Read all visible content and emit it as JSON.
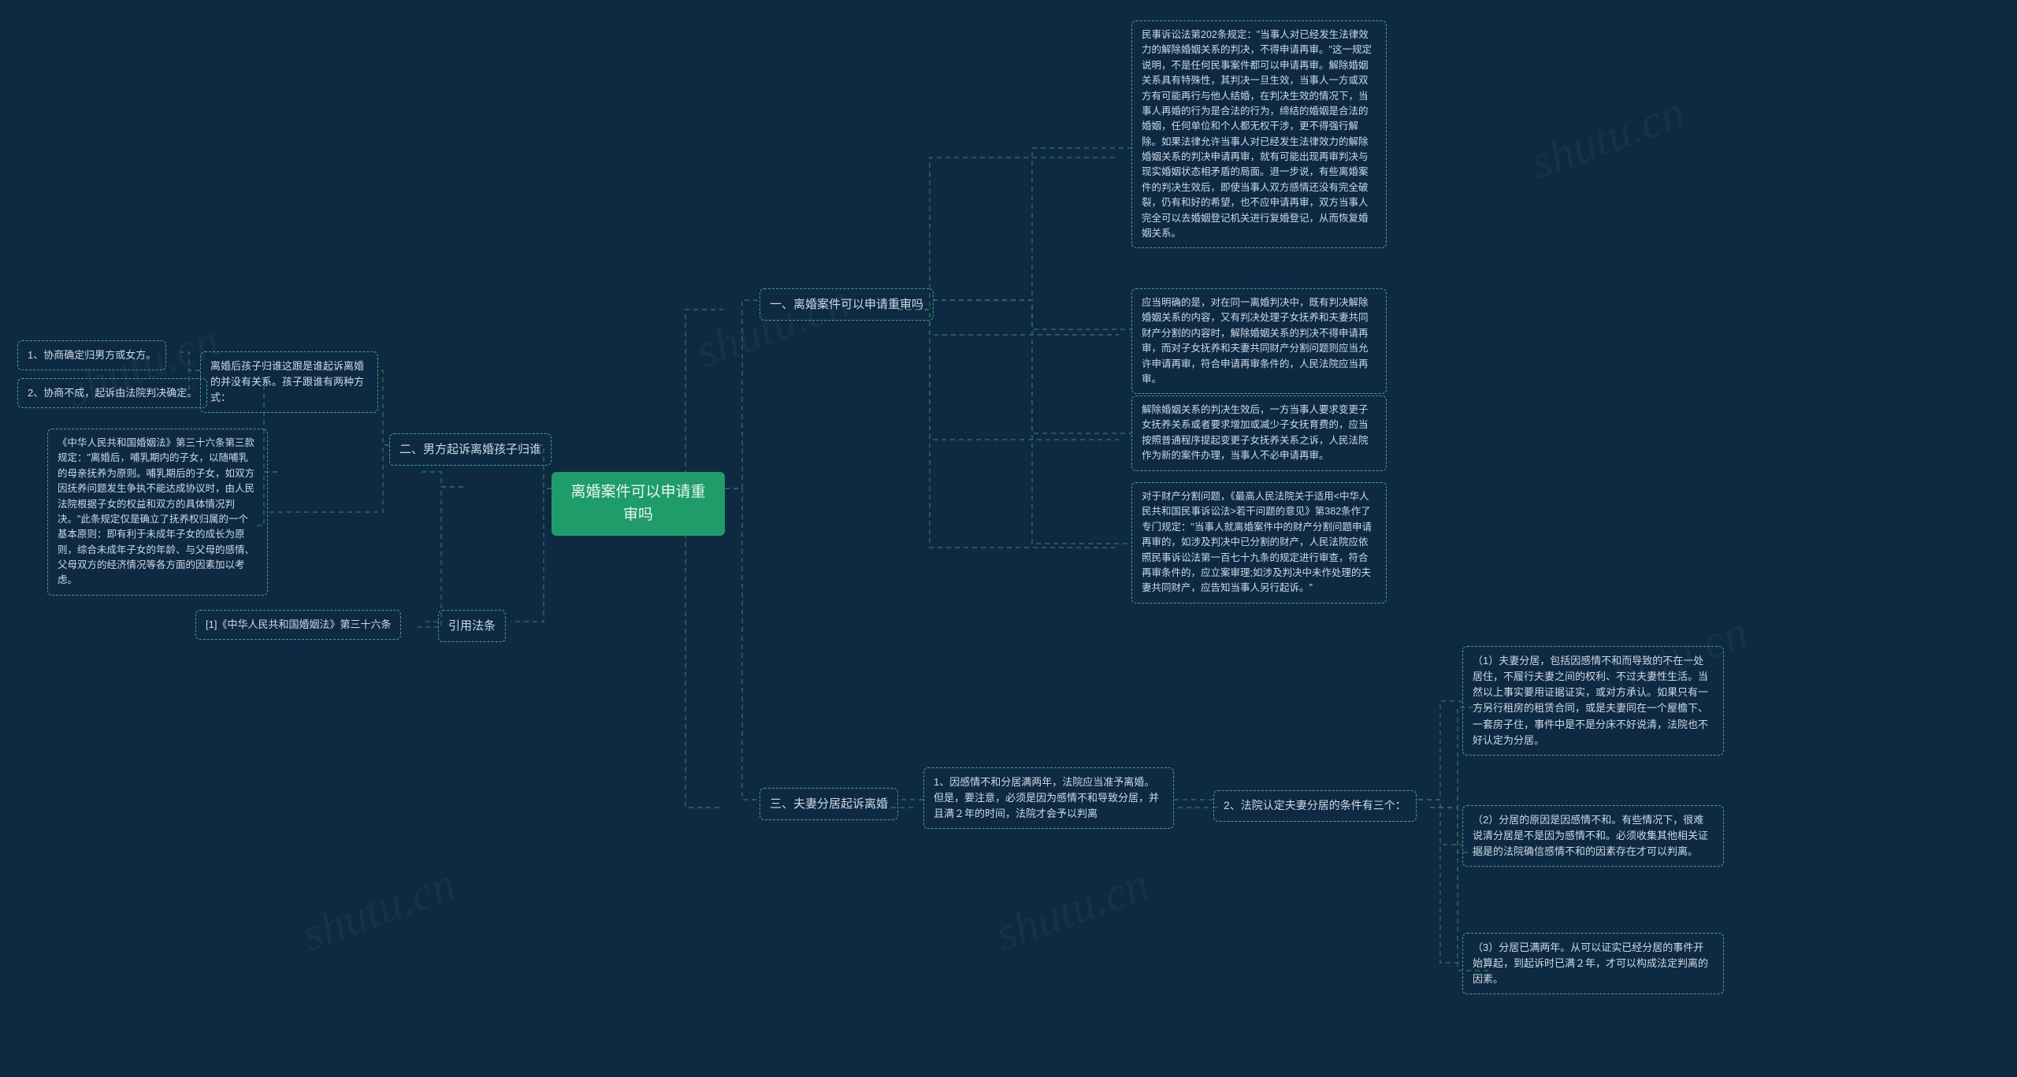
{
  "watermark": "shutu.cn",
  "center": {
    "label": "离婚案件可以申请重审吗"
  },
  "right1": {
    "title": "一、离婚案件可以申请重审吗",
    "p1": "民事诉讼法第202条规定：\"当事人对已经发生法律效力的解除婚姻关系的判决，不得申请再审。\"这一规定说明，不是任何民事案件都可以申请再审。解除婚姻关系具有特殊性，其判决一旦生效，当事人一方或双方有可能再行与他人结婚，在判决生效的情况下，当事人再婚的行为是合法的行为，缔结的婚姻是合法的婚姻，任何单位和个人都无权干涉，更不得强行解除。如果法律允许当事人对已经发生法律效力的解除婚姻关系的判决申请再审，就有可能出现再审判决与现实婚姻状态相矛盾的局面。退一步说，有些离婚案件的判决生效后，即使当事人双方感情还没有完全破裂，仍有和好的希望，也不应申请再审，双方当事人完全可以去婚姻登记机关进行复婚登记，从而恢复婚姻关系。",
    "p2": "应当明确的是，对在同一离婚判决中，既有判决解除婚姻关系的内容，又有判决处理子女抚养和夫妻共同财产分割的内容时，解除婚姻关系的判决不得申请再审，而对子女抚养和夫妻共同财产分割问题则应当允许申请再审，符合申请再审条件的，人民法院应当再审。",
    "p3": "解除婚姻关系的判决生效后，一方当事人要求变更子女抚养关系或者要求增加或减少子女抚育费的，应当按照普通程序提起变更子女抚养关系之诉，人民法院作为新的案件办理，当事人不必申请再审。",
    "p4": "对于财产分割问题，《最高人民法院关于适用<中华人民共和国民事诉讼法>若干问题的意见》第382条作了专门规定：\"当事人就离婚案件中的财产分割问题申请再审的，如涉及判决中已分割的财产，人民法院应依照民事诉讼法第一百七十九条的规定进行审查，符合再审条件的，应立案审理;如涉及判决中未作处理的夫妻共同财产，应告知当事人另行起诉。\""
  },
  "left2": {
    "title": "二、男方起诉离婚孩子归谁",
    "p1": "离婚后孩子归谁这跟是谁起诉离婚的并没有关系。孩子跟谁有两种方式：",
    "p1a": "1、协商确定归男方或女方。",
    "p1b": "2、协商不成，起诉由法院判决确定。",
    "p2": "《中华人民共和国婚姻法》第三十六条第三款规定：\"离婚后，哺乳期内的子女，以随哺乳的母亲抚养为原则。哺乳期后的子女，如双方因抚养问题发生争执不能达成协议时，由人民法院根据子女的权益和双方的具体情况判决。\"此条规定仅是确立了抚养权归属的一个基本原则：即有利于未成年子女的成长为原则，综合未成年子女的年龄、与父母的感情、父母双方的经济情况等各方面的因素加以考虑。"
  },
  "right3": {
    "title": "三、夫妻分居起诉离婚",
    "p1": "1、因感情不和分居满两年，法院应当准予离婚。但是，要注意，必须是因为感情不和导致分居，并且满２年的时间，法院才会予以判离",
    "p2title": "2、法院认定夫妻分居的条件有三个：",
    "p2a": "（1）夫妻分居，包括因感情不和而导致的不在一处居住，不履行夫妻之间的权利、不过夫妻性生活。当然以上事实要用证据证实，或对方承认。如果只有一方另行租房的租赁合同，或是夫妻同在一个屋檐下、一套房子住，事件中是不是分床不好说清，法院也不好认定为分居。",
    "p2b": "（2）分居的原因是因感情不和。有些情况下，很难说清分居是不是因为感情不和。必须收集其他相关证据是的法院确信感情不和的因素存在才可以判离。",
    "p2c": "（3）分居已满两年。从可以证实已经分居的事件开始算起，到起诉时已满２年，才可以构成法定判离的因素。"
  },
  "leftRefs": {
    "title": "引用法条",
    "p1": "[1]《中华人民共和国婚姻法》第三十六条"
  }
}
